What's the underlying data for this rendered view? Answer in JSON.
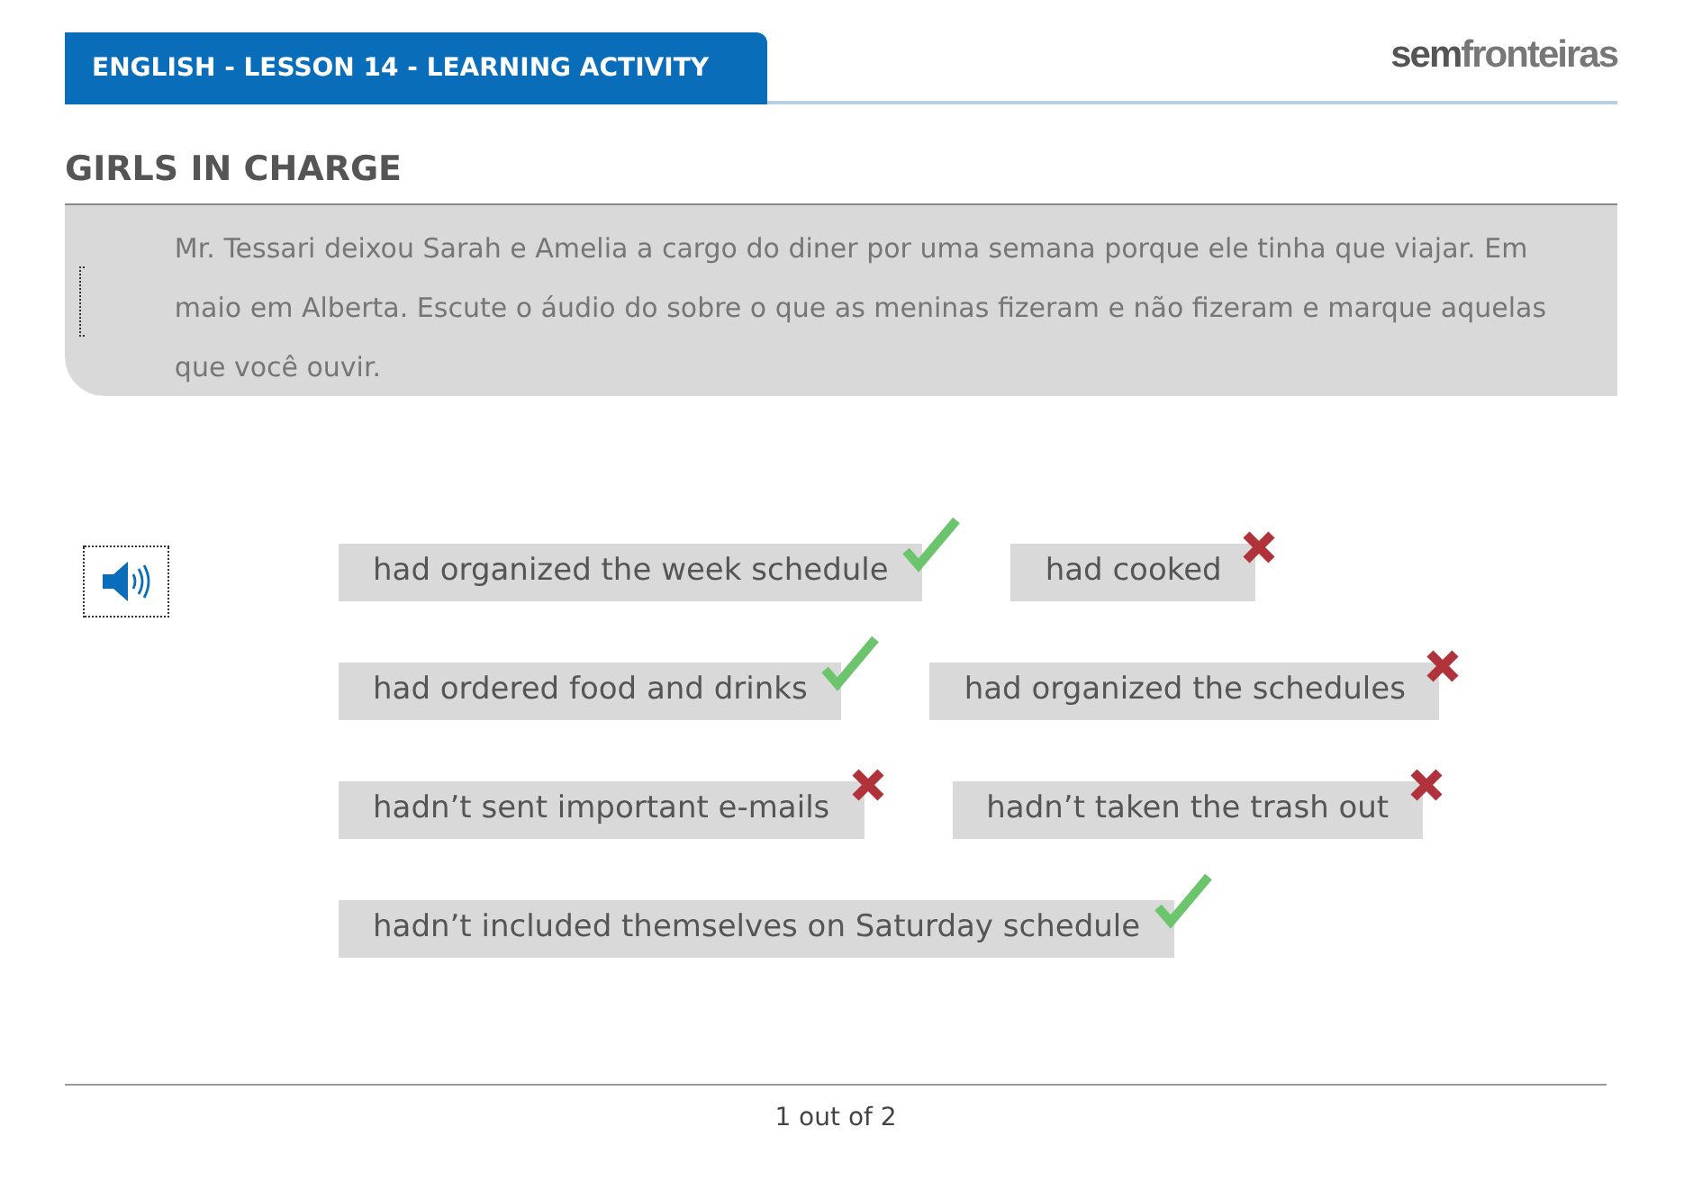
{
  "header": {
    "lesson_title": "ENGLISH - LESSON 14 - LEARNING ACTIVITY",
    "logo": {
      "part1": "sem",
      "part2": "fronteiras"
    }
  },
  "activity_title": "GIRLS IN CHARGE",
  "instructions": "Mr. Tessari deixou Sarah e Amelia a cargo do diner por uma semana porque ele tinha que viajar. Em maio em Alberta. Escute o áudio do sobre o que as meninas fizeram e não fizeram e marque aquelas que você ouvir.",
  "option_rows": [
    [
      {
        "label": "had organized the week schedule",
        "correct": true
      },
      {
        "label": "had cooked",
        "correct": false
      }
    ],
    [
      {
        "label": "had ordered food and drinks",
        "correct": true
      },
      {
        "label": "had organized the schedules",
        "correct": false
      }
    ],
    [
      {
        "label": "hadn’t sent important e-mails",
        "correct": false
      },
      {
        "label": "hadn’t taken the trash out",
        "correct": false
      }
    ],
    [
      {
        "label": "hadn’t included themselves on Saturday schedule",
        "correct": true
      }
    ]
  ],
  "pager": "1 out of 2"
}
